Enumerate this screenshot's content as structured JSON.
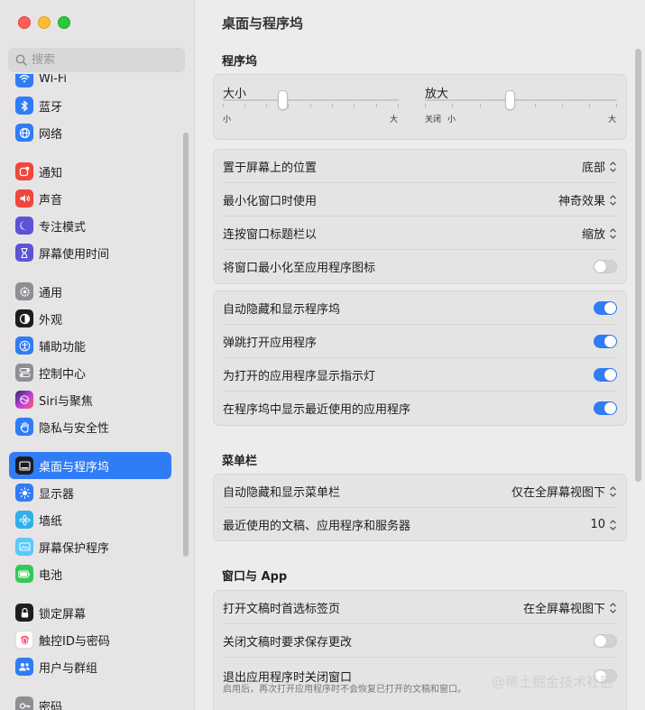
{
  "window": {
    "title": "桌面与程序坞"
  },
  "search": {
    "placeholder": "搜索"
  },
  "sidebar": {
    "items": [
      {
        "label": "Wi-Fi",
        "icon": "wifi-icon",
        "color": "#2f7cf6"
      },
      {
        "label": "蓝牙",
        "icon": "bluetooth-icon",
        "color": "#2f7cf6"
      },
      {
        "label": "网络",
        "icon": "globe-icon",
        "color": "#2f7cf6"
      },
      {
        "label": "通知",
        "icon": "notification-icon",
        "color": "#f0463b"
      },
      {
        "label": "声音",
        "icon": "sound-icon",
        "color": "#f0463b"
      },
      {
        "label": "专注模式",
        "icon": "moon-icon",
        "color": "#5d53d6"
      },
      {
        "label": "屏幕使用时间",
        "icon": "hourglass-icon",
        "color": "#5d53d6"
      },
      {
        "label": "通用",
        "icon": "gear-icon",
        "color": "#8e8e93"
      },
      {
        "label": "外观",
        "icon": "appearance-icon",
        "color": "#1d1d1f"
      },
      {
        "label": "辅助功能",
        "icon": "accessibility-icon",
        "color": "#2f7cf6"
      },
      {
        "label": "控制中心",
        "icon": "control-center-icon",
        "color": "#8e8e93"
      },
      {
        "label": "Siri与聚焦",
        "icon": "siri-icon",
        "color": "#c43fd9"
      },
      {
        "label": "隐私与安全性",
        "icon": "hand-icon",
        "color": "#2f7cf6"
      },
      {
        "label": "桌面与程序坞",
        "icon": "dock-icon",
        "color": "#1d1d1f"
      },
      {
        "label": "显示器",
        "icon": "sun-icon",
        "color": "#2f7cf6"
      },
      {
        "label": "墙纸",
        "icon": "wallpaper-icon",
        "color": "#30b0e8"
      },
      {
        "label": "屏幕保护程序",
        "icon": "screensaver-icon",
        "color": "#5ac8fa"
      },
      {
        "label": "电池",
        "icon": "battery-icon",
        "color": "#34c759"
      },
      {
        "label": "锁定屏幕",
        "icon": "lock-icon",
        "color": "#1d1d1f"
      },
      {
        "label": "触控ID与密码",
        "icon": "fingerprint-icon",
        "color": "#ffffff"
      },
      {
        "label": "用户与群组",
        "icon": "users-icon",
        "color": "#2f7cf6"
      },
      {
        "label": "密码",
        "icon": "key-icon",
        "color": "#8e8e93"
      }
    ],
    "active_index": 13
  },
  "main": {
    "dock_section": "程序坞",
    "size": {
      "title": "大小",
      "min": "小",
      "max": "大",
      "value": 0.34
    },
    "magnify": {
      "title": "放大",
      "off": "关闭",
      "min": "小",
      "max": "大",
      "value": 0.44
    },
    "position_row": {
      "label": "置于屏幕上的位置",
      "value": "底部"
    },
    "minimize_row": {
      "label": "最小化窗口时使用",
      "value": "神奇效果"
    },
    "double_click_row": {
      "label": "连按窗口标题栏以",
      "value": "缩放"
    },
    "minimize_into_icon_row": {
      "label": "将窗口最小化至应用程序图标",
      "on": false
    },
    "autohide_row": {
      "label": "自动隐藏和显示程序坞",
      "on": true
    },
    "bounce_row": {
      "label": "弹跳打开应用程序",
      "on": true
    },
    "indicator_row": {
      "label": "为打开的应用程序显示指示灯",
      "on": true
    },
    "recent_row": {
      "label": "在程序坞中显示最近使用的应用程序",
      "on": true
    },
    "menubar_section": "菜单栏",
    "menubar_autohide_row": {
      "label": "自动隐藏和显示菜单栏",
      "value": "仅在全屏幕视图下"
    },
    "recent_items_row": {
      "label": "最近使用的文稿、应用程序和服务器",
      "value": "10"
    },
    "windows_section": "窗口与 App",
    "prefer_tabs_row": {
      "label": "打开文稿时首选标签页",
      "value": "在全屏幕视图下"
    },
    "ask_save_row": {
      "label": "关闭文稿时要求保存更改",
      "on": false
    },
    "close_windows_row": {
      "label": "退出应用程序时关闭窗口",
      "note": "启用后，再次打开应用程序时不会恢复已打开的文稿和窗口。",
      "on": false
    }
  },
  "watermark": "@稀土掘金技术社区",
  "colors": {
    "accent": "#2f7cf6",
    "sidebar_bg": "#e6e4e5",
    "content_bg": "#ececec",
    "card_bg": "#e4e4e4"
  }
}
